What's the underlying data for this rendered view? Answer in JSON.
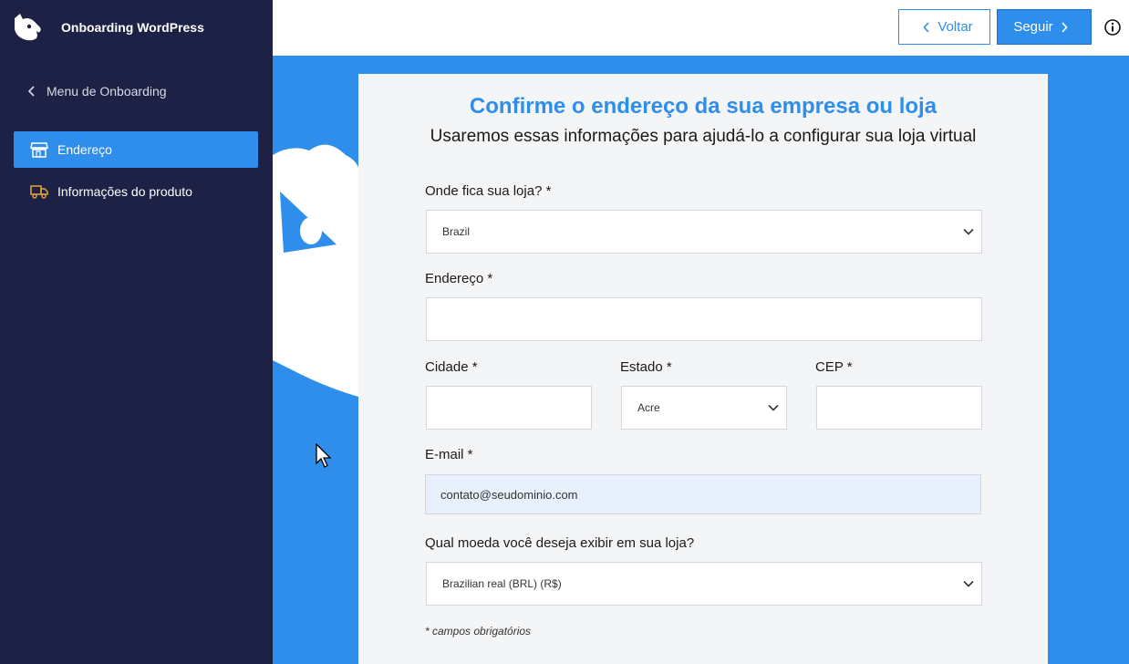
{
  "app": {
    "title": "Onboarding WordPress"
  },
  "sidebar": {
    "back_label": "Menu de Onboarding",
    "items": [
      {
        "label": "Endereço",
        "icon": "store-icon",
        "active": true
      },
      {
        "label": "Informações do produto",
        "icon": "truck-icon",
        "active": false
      }
    ]
  },
  "toolbar": {
    "back_label": "Voltar",
    "next_label": "Seguir",
    "info_icon": "info-icon"
  },
  "form": {
    "title": "Confirme o endereço da sua empresa ou loja",
    "subtitle": "Usaremos essas informações para ajudá-lo a configurar sua loja virtual",
    "country_label": "Onde fica sua loja? *",
    "country_value": "Brazil",
    "address_label": "Endereço *",
    "address_value": "",
    "city_label": "Cidade *",
    "city_value": "",
    "state_label": "Estado *",
    "state_value": "Acre",
    "zip_label": "CEP *",
    "zip_value": "",
    "email_label": "E-mail *",
    "email_value": "contato@seudominio.com",
    "currency_label": "Qual moeda você deseja exibir em sua loja?",
    "currency_value": "Brazilian real (BRL) (R$)",
    "footnote": "* campos obrigatórios"
  },
  "colors": {
    "sidebar_bg": "#1d2145",
    "accent": "#2f8eec",
    "card_bg": "#f4f5f7"
  }
}
